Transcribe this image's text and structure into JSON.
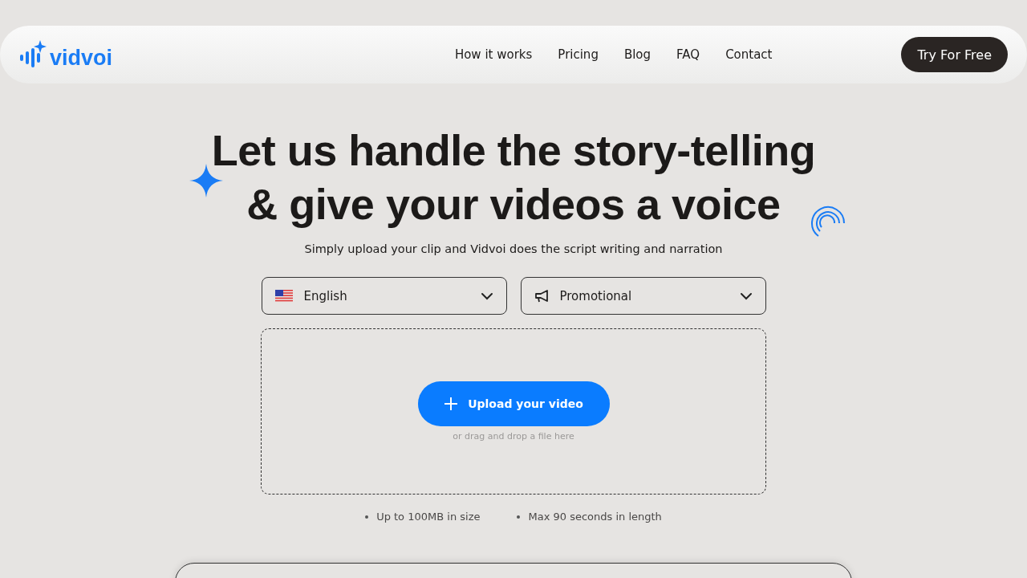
{
  "header": {
    "logo": "vidvoi",
    "nav": [
      "How it works",
      "Pricing",
      "Blog",
      "FAQ",
      "Contact"
    ],
    "cta": "Try For Free"
  },
  "hero": {
    "title_lines": [
      "Let us handle the story-telling",
      "& give your videos a voice"
    ],
    "subtitle": "Simply upload your clip and Vidvoi does the script writing and narration"
  },
  "selects": [
    {
      "kind": "language",
      "value": "English"
    },
    {
      "kind": "style",
      "value": "Promotional"
    }
  ],
  "upload": {
    "button": "Upload your video",
    "hint": "or drag and drop a file here"
  },
  "limits": [
    "Up to 100MB in size",
    "Max 90 seconds in length"
  ]
}
